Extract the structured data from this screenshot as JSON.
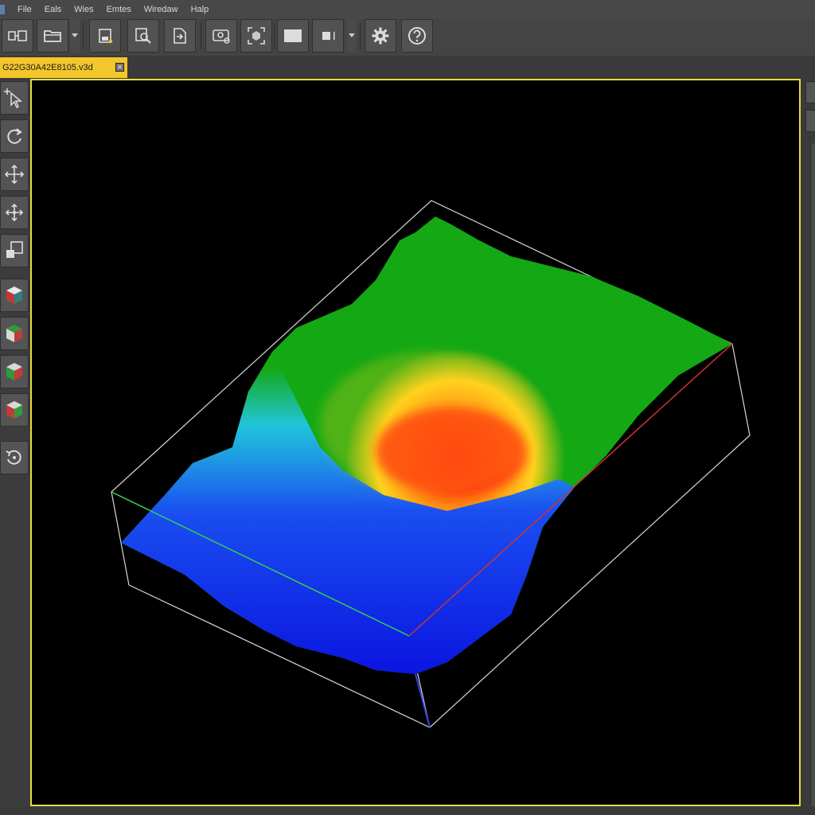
{
  "menubar": {
    "items": [
      "File",
      "Eals",
      "Wies",
      "Emtes",
      "Wiredaw",
      "Halp"
    ]
  },
  "toolbar": {
    "buttons": [
      {
        "name": "new-file-icon"
      },
      {
        "name": "open-folder-icon"
      },
      {
        "name": "save-icon"
      },
      {
        "name": "inspect-icon"
      },
      {
        "name": "export-icon"
      },
      {
        "name": "capture-icon"
      },
      {
        "name": "fit-view-icon"
      },
      {
        "name": "display-mode-icon"
      },
      {
        "name": "stop-icon"
      },
      {
        "name": "settings-icon"
      },
      {
        "name": "help-icon"
      }
    ]
  },
  "document": {
    "tab_label": "G22G30A42E8105.v3d"
  },
  "left_tools": [
    {
      "name": "select-arrow-icon"
    },
    {
      "name": "rotate-icon"
    },
    {
      "name": "pan-icon"
    },
    {
      "name": "move-icon"
    },
    {
      "name": "scale-icon"
    },
    {
      "name": "view-cube-icon"
    },
    {
      "name": "view-front-icon"
    },
    {
      "name": "view-side-icon"
    },
    {
      "name": "view-top-icon"
    },
    {
      "name": "reset-view-icon"
    }
  ],
  "viewport": {
    "background": "#000000",
    "frame_color": "#e9dc3c",
    "colormap": [
      "#0a10e0",
      "#1a4ff0",
      "#22c8f0",
      "#14a814",
      "#ffd21e",
      "#ff7a10",
      "#ff1e10"
    ],
    "axes": {
      "x_axis_color": "#cc3333",
      "y_axis_color": "#33cc55",
      "z_axis_color": "#3344dd"
    }
  }
}
